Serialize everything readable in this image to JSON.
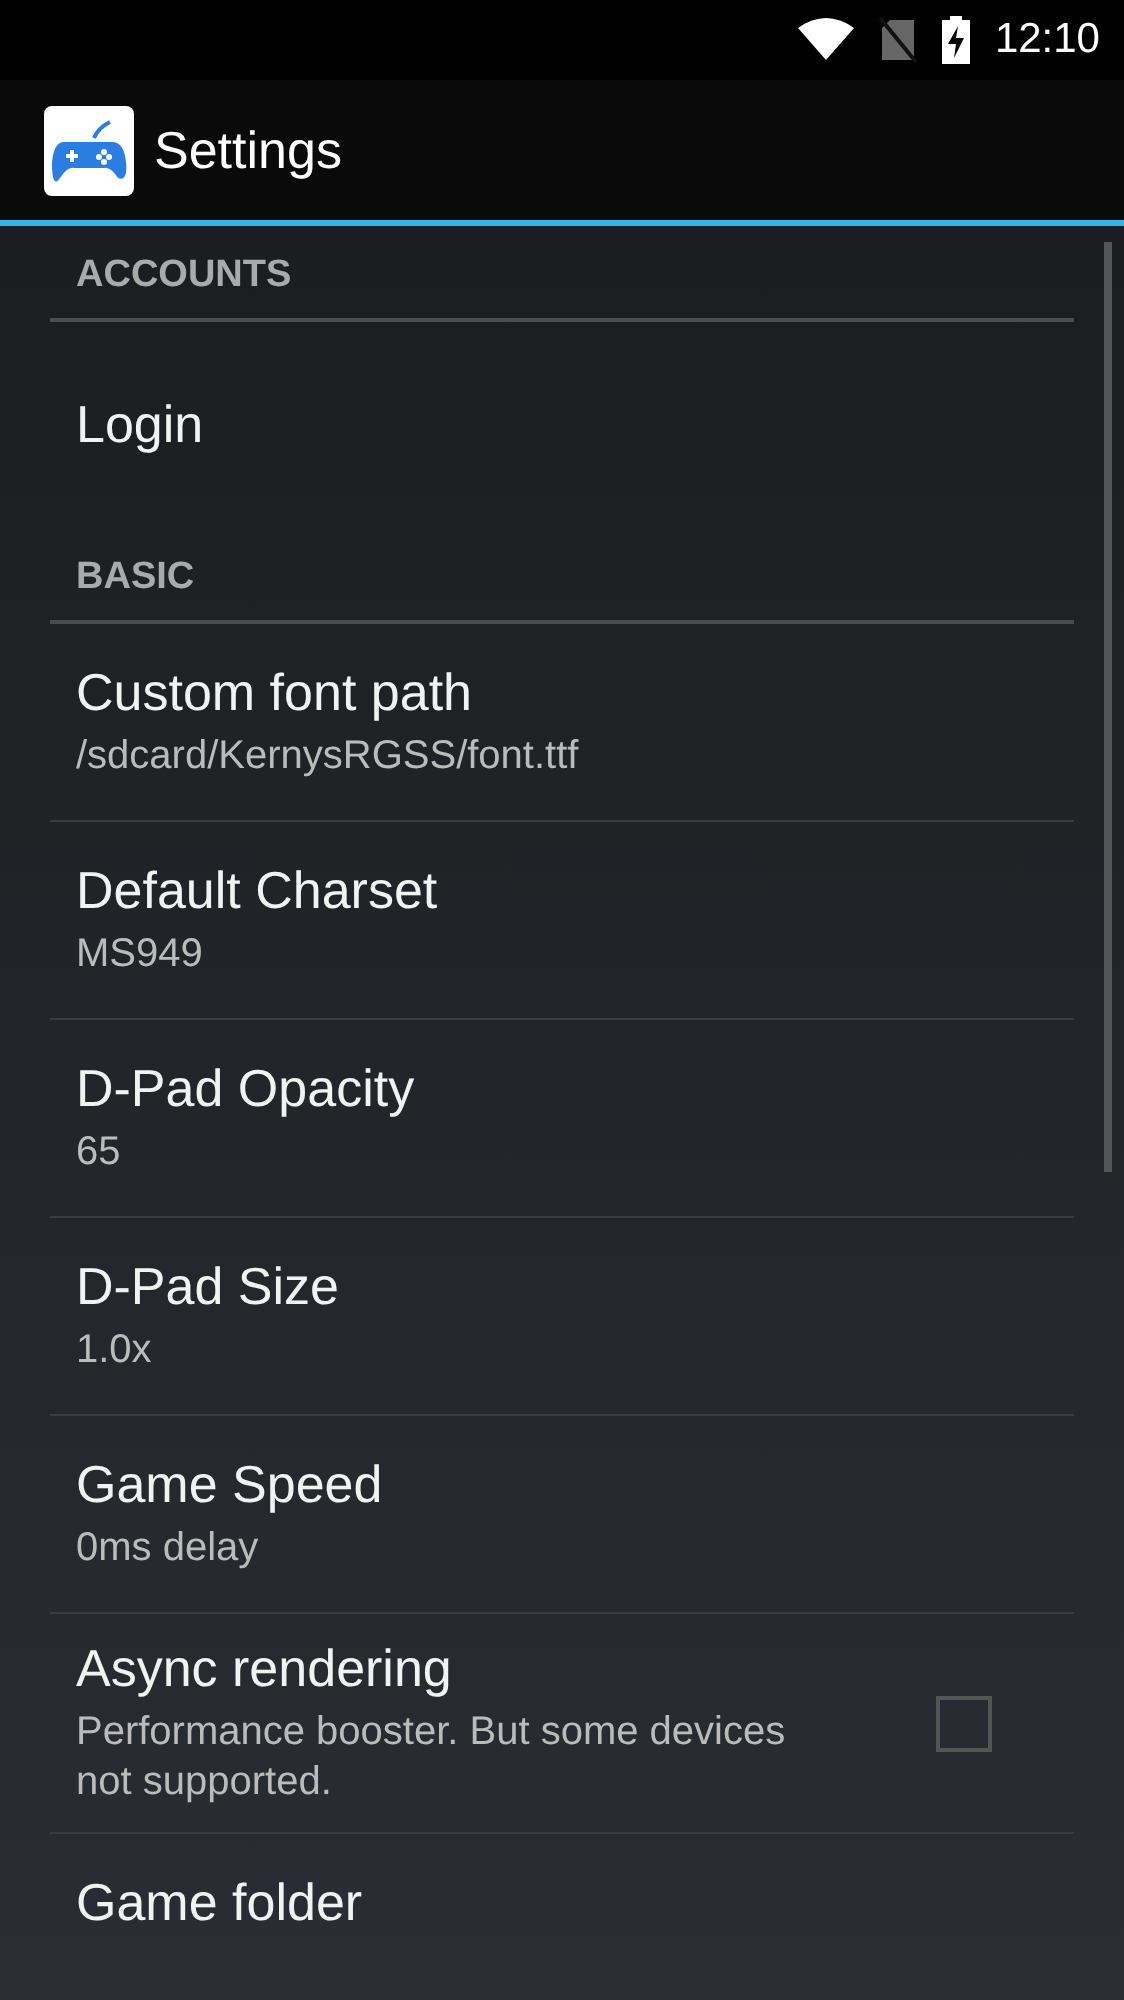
{
  "status_bar": {
    "time": "12:10"
  },
  "app_bar": {
    "title": "Settings"
  },
  "sections": [
    {
      "header": "ACCOUNTS",
      "items": [
        {
          "kind": "plain",
          "title": "Login"
        }
      ]
    },
    {
      "header": "BASIC",
      "items": [
        {
          "kind": "plain",
          "title": "Custom font path",
          "summary": "/sdcard/KernysRGSS/font.ttf"
        },
        {
          "kind": "plain",
          "title": "Default Charset",
          "summary": "MS949"
        },
        {
          "kind": "plain",
          "title": "D-Pad Opacity",
          "summary": "65"
        },
        {
          "kind": "plain",
          "title": "D-Pad Size",
          "summary": "1.0x"
        },
        {
          "kind": "plain",
          "title": "Game Speed",
          "summary": "0ms delay"
        },
        {
          "kind": "checkbox",
          "title": "Async rendering",
          "summary": "Performance booster. But some devices not supported.",
          "checked": false
        },
        {
          "kind": "plain",
          "title": "Game folder"
        }
      ]
    }
  ]
}
